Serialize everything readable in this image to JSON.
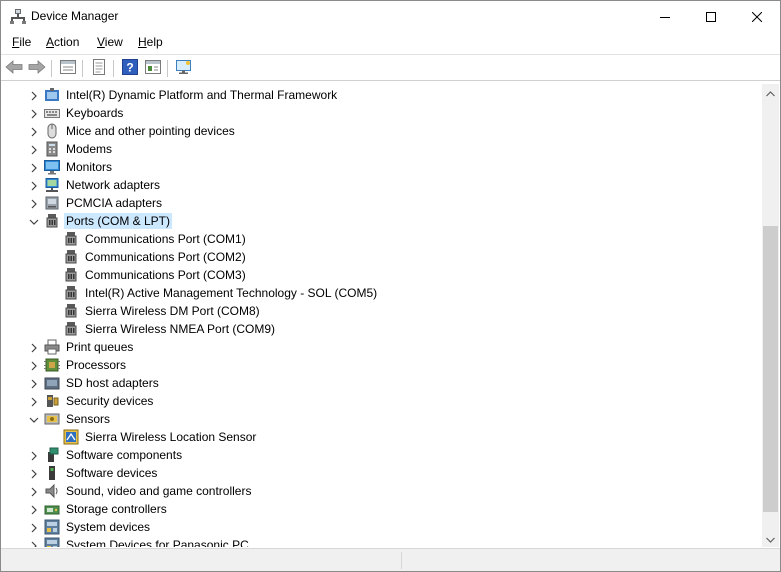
{
  "window": {
    "title": "Device Manager",
    "title_icon": "device-manager-icon"
  },
  "menu": {
    "items": [
      {
        "label": "File",
        "underline": "F"
      },
      {
        "label": "Action",
        "underline": "A"
      },
      {
        "label": "View",
        "underline": "V"
      },
      {
        "label": "Help",
        "underline": "H"
      }
    ]
  },
  "toolbar": {
    "buttons": [
      "back-arrow-icon",
      "forward-arrow-icon",
      "properties-icon",
      "update-driver-icon",
      "help-icon",
      "view-toggle-icon",
      "monitor-scan-icon"
    ]
  },
  "tree": {
    "rows": [
      {
        "label": "Intel(R) Dynamic Platform and Thermal Framework",
        "level": 0,
        "expanded": false,
        "icon": "chip-icon"
      },
      {
        "label": "Keyboards",
        "level": 0,
        "expanded": false,
        "icon": "keyboard-icon"
      },
      {
        "label": "Mice and other pointing devices",
        "level": 0,
        "expanded": false,
        "icon": "mouse-icon"
      },
      {
        "label": "Modems",
        "level": 0,
        "expanded": false,
        "icon": "modem-icon"
      },
      {
        "label": "Monitors",
        "level": 0,
        "expanded": false,
        "icon": "monitor-icon"
      },
      {
        "label": "Network adapters",
        "level": 0,
        "expanded": false,
        "icon": "network-icon"
      },
      {
        "label": "PCMCIA adapters",
        "level": 0,
        "expanded": false,
        "icon": "pcmcia-icon"
      },
      {
        "label": "Ports (COM & LPT)",
        "level": 0,
        "expanded": true,
        "icon": "port-icon",
        "selected": true
      },
      {
        "label": "Communications Port (COM1)",
        "level": 1,
        "icon": "port-icon"
      },
      {
        "label": "Communications Port (COM2)",
        "level": 1,
        "icon": "port-icon"
      },
      {
        "label": "Communications Port (COM3)",
        "level": 1,
        "icon": "port-icon"
      },
      {
        "label": "Intel(R) Active Management Technology - SOL (COM5)",
        "level": 1,
        "icon": "port-icon"
      },
      {
        "label": "Sierra Wireless DM Port (COM8)",
        "level": 1,
        "icon": "port-icon"
      },
      {
        "label": "Sierra Wireless NMEA Port (COM9)",
        "level": 1,
        "icon": "port-icon"
      },
      {
        "label": "Print queues",
        "level": 0,
        "expanded": false,
        "icon": "printer-icon"
      },
      {
        "label": "Processors",
        "level": 0,
        "expanded": false,
        "icon": "processor-icon"
      },
      {
        "label": "SD host adapters",
        "level": 0,
        "expanded": false,
        "icon": "sd-card-icon"
      },
      {
        "label": "Security devices",
        "level": 0,
        "expanded": false,
        "icon": "security-icon"
      },
      {
        "label": "Sensors",
        "level": 0,
        "expanded": true,
        "icon": "sensor-icon"
      },
      {
        "label": "Sierra Wireless Location Sensor",
        "level": 1,
        "icon": "location-sensor-icon"
      },
      {
        "label": "Software components",
        "level": 0,
        "expanded": false,
        "icon": "software-component-icon"
      },
      {
        "label": "Software devices",
        "level": 0,
        "expanded": false,
        "icon": "software-device-icon"
      },
      {
        "label": "Sound, video and game controllers",
        "level": 0,
        "expanded": false,
        "icon": "speaker-icon"
      },
      {
        "label": "Storage controllers",
        "level": 0,
        "expanded": false,
        "icon": "storage-icon"
      },
      {
        "label": "System devices",
        "level": 0,
        "expanded": false,
        "icon": "system-device-icon"
      },
      {
        "label": "System Devices for Panasonic PC",
        "level": 0,
        "expanded": false,
        "icon": "system-device-icon"
      }
    ]
  },
  "colors": {
    "selection": "#cce8ff",
    "scroll_thumb": "#cdcdcd",
    "scroll_track": "#f0f0f0"
  }
}
